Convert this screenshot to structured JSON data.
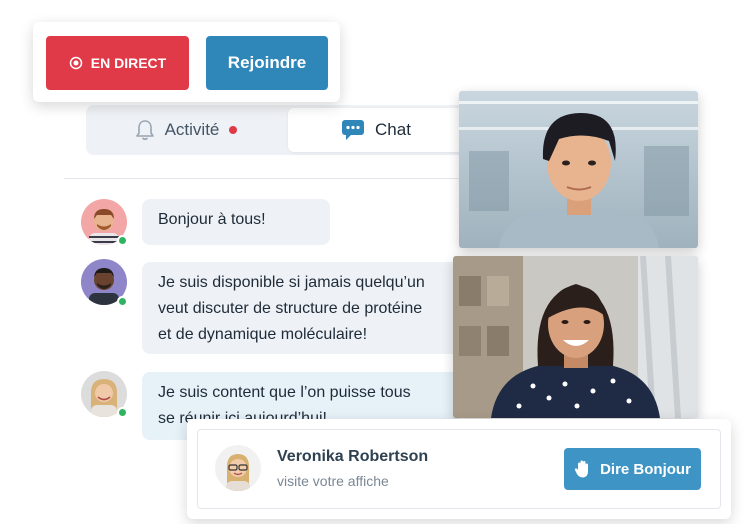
{
  "live_card": {
    "live_label": "EN DIRECT",
    "join_label": "Rejoindre"
  },
  "tabs": {
    "activity_label": "Activité",
    "chat_label": "Chat"
  },
  "chat": {
    "messages": [
      {
        "text": "Bonjour à tous!"
      },
      {
        "line1": "Je suis disponible si jamais quelqu’un",
        "line2": "veut discuter de structure de protéine",
        "line3": "et de dynamique moléculaire!"
      },
      {
        "line1": "Je suis content que l’on puisse tous",
        "line2": "se réunir ici aujourd’hui!"
      }
    ]
  },
  "visitor": {
    "name": "Veronika Robertson",
    "subtitle": "visite votre affiche",
    "button_label": "Dire Bonjour"
  },
  "colors": {
    "live_red": "#e03a48",
    "join_blue": "#2f86b8",
    "online_green": "#2fb360",
    "hello_blue": "#3f94c6"
  },
  "icons": [
    "live-icon",
    "bell-icon",
    "chat-bubble-icon",
    "wave-hand-icon"
  ]
}
